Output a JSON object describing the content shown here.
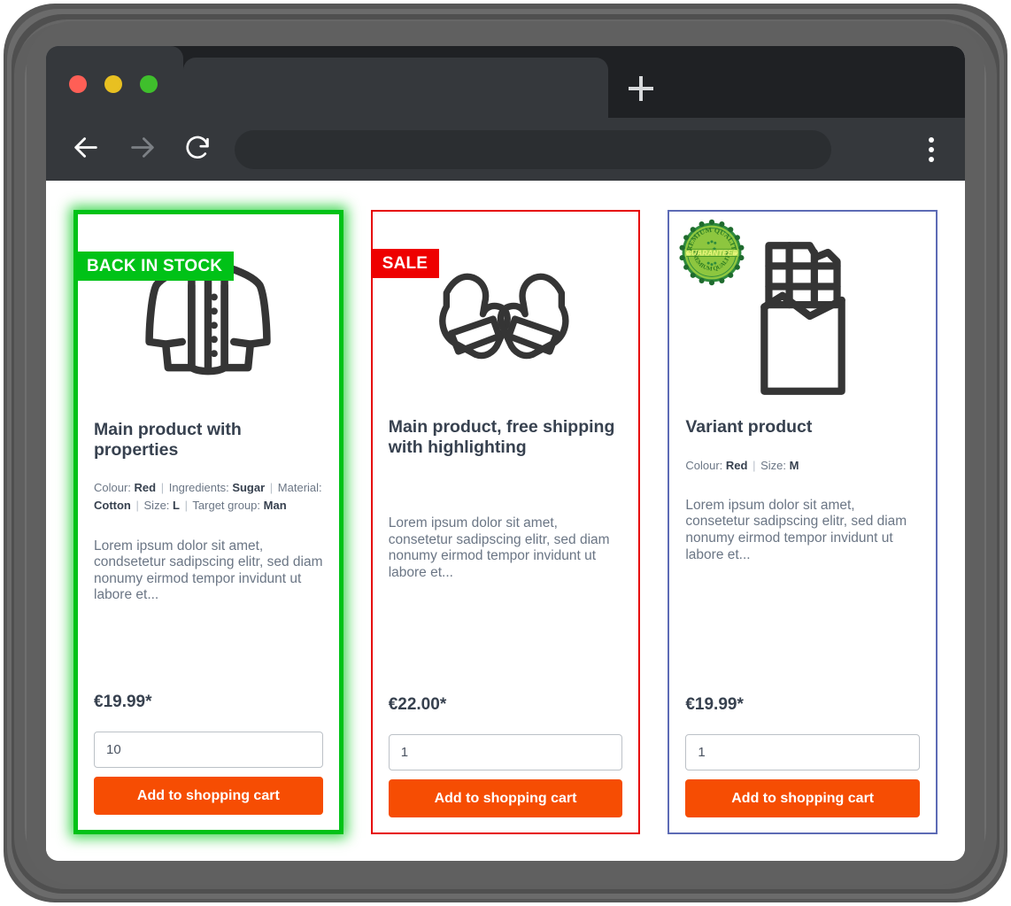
{
  "browser": {
    "traffic_lights": [
      "close",
      "minimize",
      "maximize"
    ],
    "tab_title": "",
    "new_tab_label": "+",
    "address_value": "",
    "address_placeholder": "",
    "back_label": "Back",
    "forward_label": "Forward",
    "reload_label": "Reload",
    "menu_label": "Menu"
  },
  "page": {
    "background": "#ffffff",
    "products": [
      {
        "badge": {
          "text": "BACK IN STOCK",
          "style": "green",
          "color": "#00c217"
        },
        "border_color": "#00c217",
        "highlighted": true,
        "image_icon": "shirt-icon",
        "title": "Main product with properties",
        "properties": [
          {
            "label": "Colour:",
            "value": "Red"
          },
          {
            "label": "Ingredients:",
            "value": "Sugar"
          },
          {
            "label": "Material:",
            "value": "Cotton"
          },
          {
            "label": "Size:",
            "value": "L"
          },
          {
            "label": "Target group:",
            "value": "Man"
          }
        ],
        "description": "Lorem ipsum dolor sit amet, condsetetur sadipscing elitr, sed diam nonumy eirmod tempor invidunt ut labore et...",
        "price": "€19.99*",
        "quantity": "10",
        "cart_button": "Add to shopping cart"
      },
      {
        "badge": {
          "text": "SALE",
          "style": "red",
          "color": "#ee0000"
        },
        "border_color": "#e60000",
        "highlighted": false,
        "image_icon": "mittens-icon",
        "title": "Main product, free shipping with highlighting",
        "properties": [],
        "description": "Lorem ipsum dolor sit amet, consetetur sadipscing elitr, sed diam nonumy eirmod tempor invidunt ut labore et...",
        "price": "€22.00*",
        "quantity": "1",
        "cart_button": "Add to shopping cart"
      },
      {
        "badge": null,
        "seal": {
          "icon": "premium-quality-seal-icon",
          "top_text": "PREMIUM QUALITY",
          "center_text": "GUARANTEED",
          "bottom_text": "PREMIUM QUALITY",
          "color": "#8dc63f"
        },
        "border_color": "#5d6bb5",
        "highlighted": false,
        "image_icon": "chocolate-bar-icon",
        "title": "Variant product",
        "properties": [
          {
            "label": "Colour:",
            "value": "Red"
          },
          {
            "label": "Size:",
            "value": "M"
          }
        ],
        "description": "Lorem ipsum dolor sit amet, consetetur sadipscing elitr, sed diam nonumy eirmod tempor invidunt ut labore et...",
        "price": "€19.99*",
        "quantity": "1",
        "cart_button": "Add to shopping cart"
      }
    ]
  },
  "theme": {
    "cart_button_color": "#f64d03",
    "title_color": "#37414f",
    "text_color": "#6b7685"
  }
}
